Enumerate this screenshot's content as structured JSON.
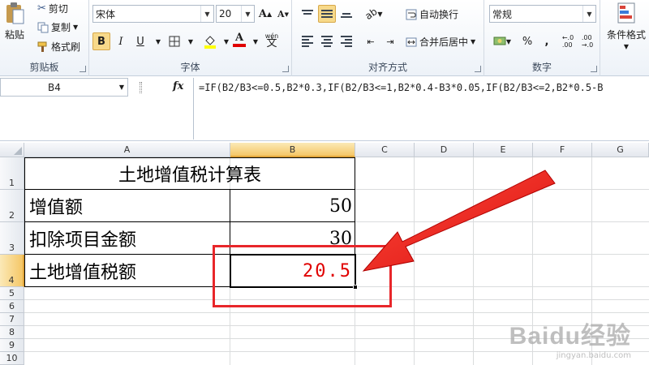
{
  "ribbon": {
    "clipboard": {
      "paste": "粘贴",
      "cut": "剪切",
      "copy": "复制",
      "format_painter": "格式刷",
      "label": "剪贴板"
    },
    "font": {
      "font_name": "宋体",
      "font_size": "20",
      "bold": "B",
      "italic": "I",
      "underline": "U",
      "grow": "A",
      "shrink": "A",
      "font_color": "A",
      "wen": "wén",
      "wen_char": "文",
      "label": "字体"
    },
    "alignment": {
      "wrap_text": "自动换行",
      "merge_center": "合并后居中",
      "label": "对齐方式"
    },
    "number": {
      "format": "常规",
      "percent": "%",
      "comma": ",",
      "label": "数字"
    },
    "styles": {
      "conditional_format": "条件格式"
    }
  },
  "formula_bar": {
    "name_box": "B4",
    "fx": "fx",
    "formula": "=IF(B2/B3<=0.5,B2*0.3,IF(B2/B3<=1,B2*0.4-B3*0.05,IF(B2/B3<=2,B2*0.5-B"
  },
  "columns": [
    "A",
    "B",
    "C",
    "D",
    "E",
    "F",
    "G"
  ],
  "rows": [
    "1",
    "2",
    "3",
    "4",
    "5",
    "6",
    "7",
    "8",
    "9",
    "10"
  ],
  "cells": {
    "A1": "土地增值税计算表",
    "A2": "增值额",
    "B2": "50",
    "A3": "扣除项目金额",
    "B3": "30",
    "A4": "土地增值税额",
    "B4": "20.5"
  },
  "colors": {
    "result_text": "#e00000",
    "annotation": "#e8262a",
    "selection": "#f5c766"
  },
  "watermark": {
    "logo": "Baidu经验",
    "url": "jingyan.baidu.com"
  }
}
